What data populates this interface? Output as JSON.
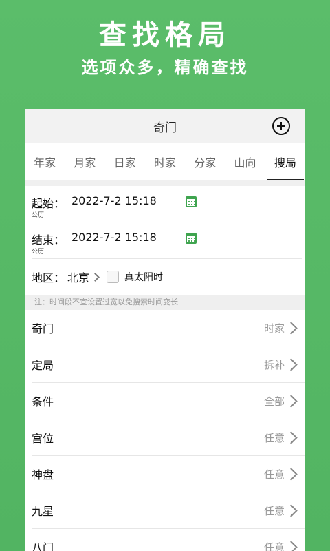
{
  "promo": {
    "title": "查找格局",
    "subtitle": "选项众多，精确查找"
  },
  "header": {
    "title": "奇门"
  },
  "tabs": [
    {
      "label": "年家",
      "active": false
    },
    {
      "label": "月家",
      "active": false
    },
    {
      "label": "日家",
      "active": false
    },
    {
      "label": "时家",
      "active": false
    },
    {
      "label": "分家",
      "active": false
    },
    {
      "label": "山向",
      "active": false
    },
    {
      "label": "搜局",
      "active": true
    }
  ],
  "start": {
    "label": "起始：",
    "value": "2022-7-2 15:18",
    "calendar": "公历"
  },
  "end": {
    "label": "结束：",
    "value": "2022-7-2 15:18",
    "calendar": "公历"
  },
  "region": {
    "label": "地区：",
    "value": "北京",
    "solar_time_label": "真太阳时"
  },
  "note": "注：时间段不宜设置过宽以免搜索时间变长",
  "options": [
    {
      "label": "奇门",
      "value": "时家"
    },
    {
      "label": "定局",
      "value": "拆补"
    },
    {
      "label": "条件",
      "value": "全部"
    },
    {
      "label": "宫位",
      "value": "任意"
    },
    {
      "label": "神盘",
      "value": "任意"
    },
    {
      "label": "九星",
      "value": "任意"
    },
    {
      "label": "八门",
      "value": "任意"
    }
  ],
  "colors": {
    "background": "#56b865",
    "accent": "#3fa44f"
  }
}
